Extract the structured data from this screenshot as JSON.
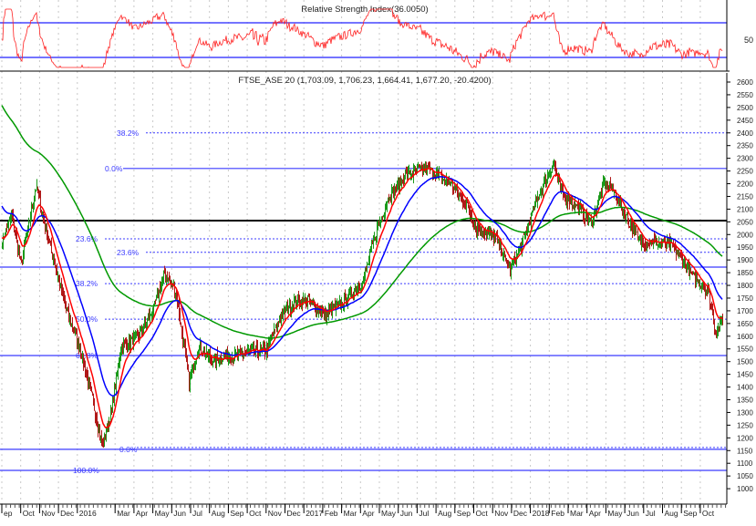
{
  "chart_data": {
    "type": "line",
    "title": "FTSE_ASE 20 (1,703.09, 1,706.23, 1,664.41, 1,677.20, -20.4200)",
    "rsi_title": "Relative Strength Index(36.0050)",
    "rsi_tick_labels": [
      "50"
    ],
    "rsi_levels": [
      30,
      70
    ],
    "ylim": [
      1000,
      2600
    ],
    "y_tick_labels": [
      "2600",
      "2550",
      "2500",
      "2450",
      "2400",
      "2350",
      "2300",
      "2250",
      "2200",
      "2150",
      "2100",
      "2050",
      "2000",
      "1950",
      "1900",
      "1850",
      "1800",
      "1750",
      "1700",
      "1650",
      "1600",
      "1550",
      "1500",
      "1450",
      "1400",
      "1350",
      "1300",
      "1250",
      "1200",
      "1150",
      "1100",
      "1050",
      "1000"
    ],
    "x_tick_labels": [
      "ep",
      "Oct",
      "Nov",
      "Dec",
      "2016",
      "Mar",
      "Apr",
      "May",
      "Jun",
      "Jul",
      "Aug",
      "Sep",
      "Oct",
      "Nov",
      "Dec",
      "2017",
      "Feb",
      "Mar",
      "Apr",
      "May",
      "Jun",
      "Jul",
      "Aug",
      "Sep",
      "Oct",
      "Nov",
      "Dec",
      "2018",
      "Feb",
      "Mar",
      "Apr",
      "May",
      "Jun",
      "Jul",
      "Aug",
      "Sep",
      "Oct"
    ],
    "x_tick_months": [
      0,
      1,
      2,
      3,
      4,
      6,
      7,
      8,
      9,
      10,
      11,
      12,
      13,
      14,
      15,
      16,
      17,
      18,
      19,
      20,
      21,
      22,
      23,
      24,
      25,
      26,
      27,
      28,
      29,
      30,
      31,
      32,
      33,
      34,
      35,
      36,
      37
    ],
    "close_anchors_month_price": [
      [
        0,
        1972
      ],
      [
        0.5,
        2080
      ],
      [
        1,
        1883
      ],
      [
        1.8,
        2188
      ],
      [
        2.3,
        2026
      ],
      [
        2.9,
        1847
      ],
      [
        3.4,
        1703
      ],
      [
        4.1,
        1560
      ],
      [
        4.8,
        1345
      ],
      [
        5.3,
        1165
      ],
      [
        5.8,
        1309
      ],
      [
        6.3,
        1560
      ],
      [
        7.2,
        1596
      ],
      [
        8,
        1703
      ],
      [
        8.6,
        1847
      ],
      [
        9.2,
        1775
      ],
      [
        9.7,
        1524
      ],
      [
        9.9,
        1418
      ],
      [
        10.4,
        1560
      ],
      [
        11.1,
        1506
      ],
      [
        12.3,
        1524
      ],
      [
        13.3,
        1542
      ],
      [
        14,
        1542
      ],
      [
        14.7,
        1667
      ],
      [
        15.5,
        1739
      ],
      [
        16.2,
        1739
      ],
      [
        17.1,
        1685
      ],
      [
        18.1,
        1739
      ],
      [
        19.1,
        1810
      ],
      [
        19.8,
        2008
      ],
      [
        20.5,
        2152
      ],
      [
        21.5,
        2241
      ],
      [
        22.5,
        2260
      ],
      [
        23.7,
        2205
      ],
      [
        24.6,
        2116
      ],
      [
        25.1,
        2026
      ],
      [
        26.1,
        1990
      ],
      [
        26.9,
        1865
      ],
      [
        27.5,
        1955
      ],
      [
        28.3,
        2134
      ],
      [
        28.7,
        2205
      ],
      [
        29.2,
        2277
      ],
      [
        29.7,
        2152
      ],
      [
        30.4,
        2116
      ],
      [
        31.2,
        2044
      ],
      [
        31.9,
        2205
      ],
      [
        32.4,
        2170
      ],
      [
        33.1,
        2062
      ],
      [
        33.8,
        1972
      ],
      [
        34.5,
        1972
      ],
      [
        35.5,
        1955
      ],
      [
        36,
        1900
      ],
      [
        36.7,
        1829
      ],
      [
        37.4,
        1775
      ],
      [
        37.8,
        1613
      ],
      [
        38.2,
        1677
      ]
    ],
    "series": [
      {
        "name": "Price (OHLC bars)",
        "color_up": "#1a9a1a",
        "color_down": "#b01818"
      },
      {
        "name": "Short moving average",
        "color": "#ff0000"
      },
      {
        "name": "Medium moving average",
        "color": "#0000ff"
      },
      {
        "name": "Long moving average",
        "color": "#009900"
      }
    ],
    "fibonacci": [
      {
        "label": "38.2%",
        "value": 2400,
        "style": "dotted"
      },
      {
        "label": "0.0%",
        "value": 2260,
        "style": "solid"
      },
      {
        "label": "23.6%",
        "value": 1983,
        "style": "dotted"
      },
      {
        "label": "23.6%",
        "value": 1930,
        "style": "dotted"
      },
      {
        "label": "38.2%",
        "value": 1807,
        "style": "dotted"
      },
      {
        "label": "50.0%",
        "value": 1667,
        "style": "dotted"
      },
      {
        "label": "61.8%",
        "value": 1524,
        "style": "solid"
      },
      {
        "label": "0.0%",
        "value": 1155,
        "style": "solid"
      },
      {
        "label": "100.0%",
        "value": 1072,
        "style": "solid"
      }
    ],
    "extra_lines": [
      {
        "value": 2055,
        "color": "#000000"
      },
      {
        "value": 1872,
        "color": "#3b3bff"
      }
    ]
  }
}
